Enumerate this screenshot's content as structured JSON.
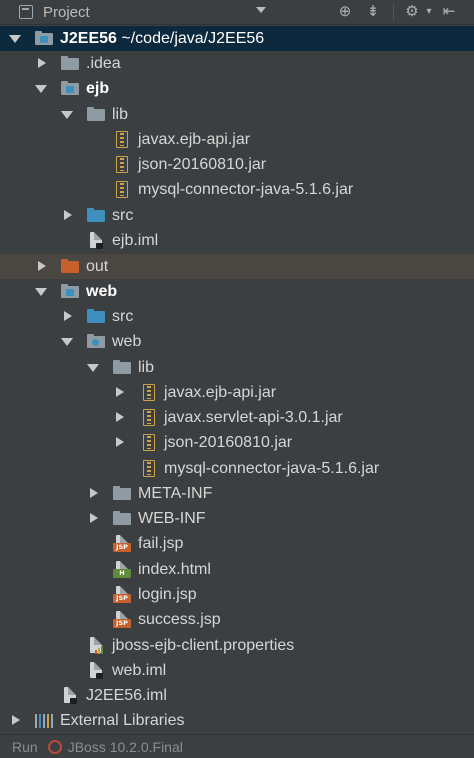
{
  "header": {
    "title": "Project",
    "icons": [
      "project-view-icon",
      "dropdown-icon",
      "locate-icon",
      "collapse-all-icon",
      "settings-icon",
      "hide-icon"
    ]
  },
  "tree": {
    "root": {
      "name": "J2EE56",
      "path": "~/code/java/J2EE56"
    },
    "idea": ".idea",
    "ejb": {
      "name": "ejb",
      "lib": "lib",
      "jars": [
        "javax.ejb-api.jar",
        "json-20160810.jar",
        "mysql-connector-java-5.1.6.jar"
      ],
      "src": "src",
      "iml": "ejb.iml"
    },
    "out": "out",
    "web": {
      "name": "web",
      "src": "src",
      "webdir": "web",
      "lib": "lib",
      "jars": [
        "javax.ejb-api.jar",
        "javax.servlet-api-3.0.1.jar",
        "json-20160810.jar",
        "mysql-connector-java-5.1.6.jar"
      ],
      "metainf": "META-INF",
      "webinf": "WEB-INF",
      "files": [
        "fail.jsp",
        "index.html",
        "login.jsp",
        "success.jsp"
      ],
      "props": "jboss-ejb-client.properties",
      "iml": "web.iml"
    },
    "root_iml": "J2EE56.iml",
    "external": "External Libraries"
  },
  "footer": {
    "run": "Run",
    "config": "JBoss 10.2.0.Final"
  },
  "colors": {
    "background": "#3c3f41",
    "selected_row": "#0d293e",
    "excluded_row": "#4a4743",
    "jsp_badge": "#c6602c",
    "html_badge": "#5f8b3a",
    "source_folder": "#3d8fbf",
    "excluded_folder": "#c6602c"
  }
}
